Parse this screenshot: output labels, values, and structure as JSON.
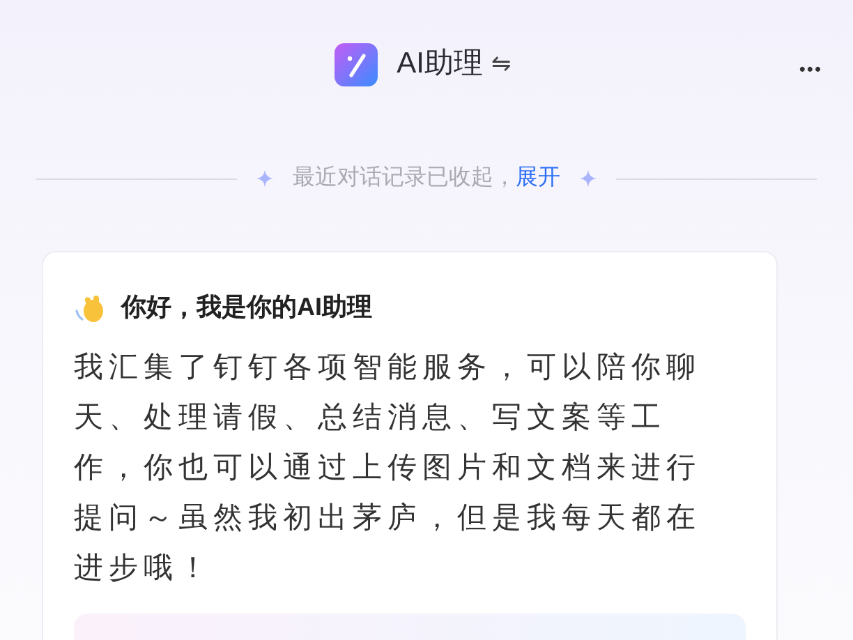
{
  "header": {
    "title": "AI助理",
    "switch_glyph": "⇋",
    "more_glyph": "•••"
  },
  "history_notice": {
    "text": "最近对话记录已收起，",
    "link": "展开"
  },
  "welcome_card": {
    "heading": "你好，我是你的AI助理",
    "body": "我汇集了钉钉各项智能服务，可以陪你聊天、处理请假、总结消息、写文案等工作，你也可以通过上传图片和文档来进行提问～虽然我初出茅庐，但是我每天都在进步哦！"
  }
}
